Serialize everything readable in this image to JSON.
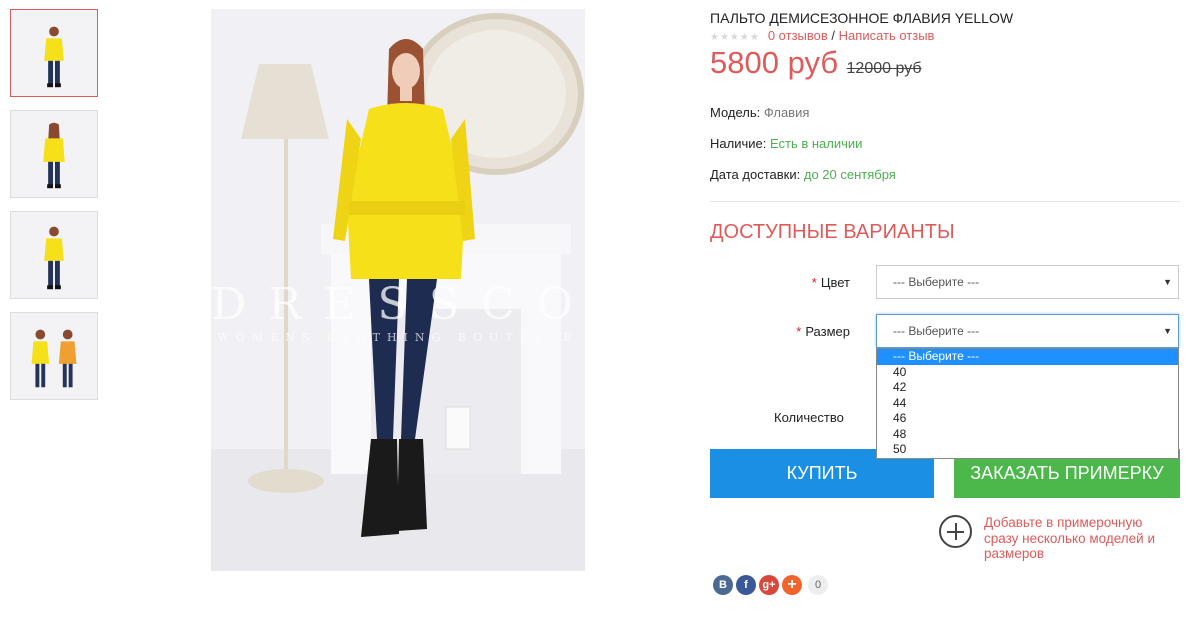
{
  "product": {
    "title": "ПАЛЬТО ДЕМИСЕЗОННОЕ ФЛАВИЯ YELLOW",
    "reviews_link": "0 отзывов",
    "separator": "/",
    "write_review_link": "Написать отзыв",
    "price": "5800 руб",
    "old_price": "12000 руб",
    "model_label": "Модель:",
    "model_value": "Флавия",
    "availability_label": "Наличие:",
    "availability_value": "Есть в наличии",
    "delivery_label": "Дата доставки:",
    "delivery_value": "до 20 сентября",
    "rating_stars": 0
  },
  "watermark": {
    "brand": "DRESSCOAT",
    "tagline": "WOMENS CLOTHING BOUTIQUE"
  },
  "options": {
    "section_title": "ДОСТУПНЫЕ ВАРИАНТЫ",
    "required_mark": "*",
    "color_label": "Цвет",
    "color_value": "--- Выберите ---",
    "size_label": "Размер",
    "size_value": "--- Выберите ---",
    "size_options": [
      "--- Выберите ---",
      "40",
      "42",
      "44",
      "46",
      "48",
      "50"
    ],
    "quantity_label": "Количество"
  },
  "actions": {
    "buy_label": "КУПИТЬ",
    "try_on_label": "ЗАКАЗАТЬ ПРИМЕРКУ",
    "fitting_hint": "Добавьте в примерочную сразу несколько моделей и размеров"
  },
  "social": {
    "vk": "В",
    "facebook": "f",
    "google_plus": "g+",
    "add": "+",
    "count": "0"
  },
  "colors": {
    "accent_red": "#e05a5a",
    "buy_blue": "#1a8fe3",
    "try_green": "#4cb84c",
    "in_stock_green": "#4caf50",
    "coat_yellow": "#f5e01a"
  }
}
